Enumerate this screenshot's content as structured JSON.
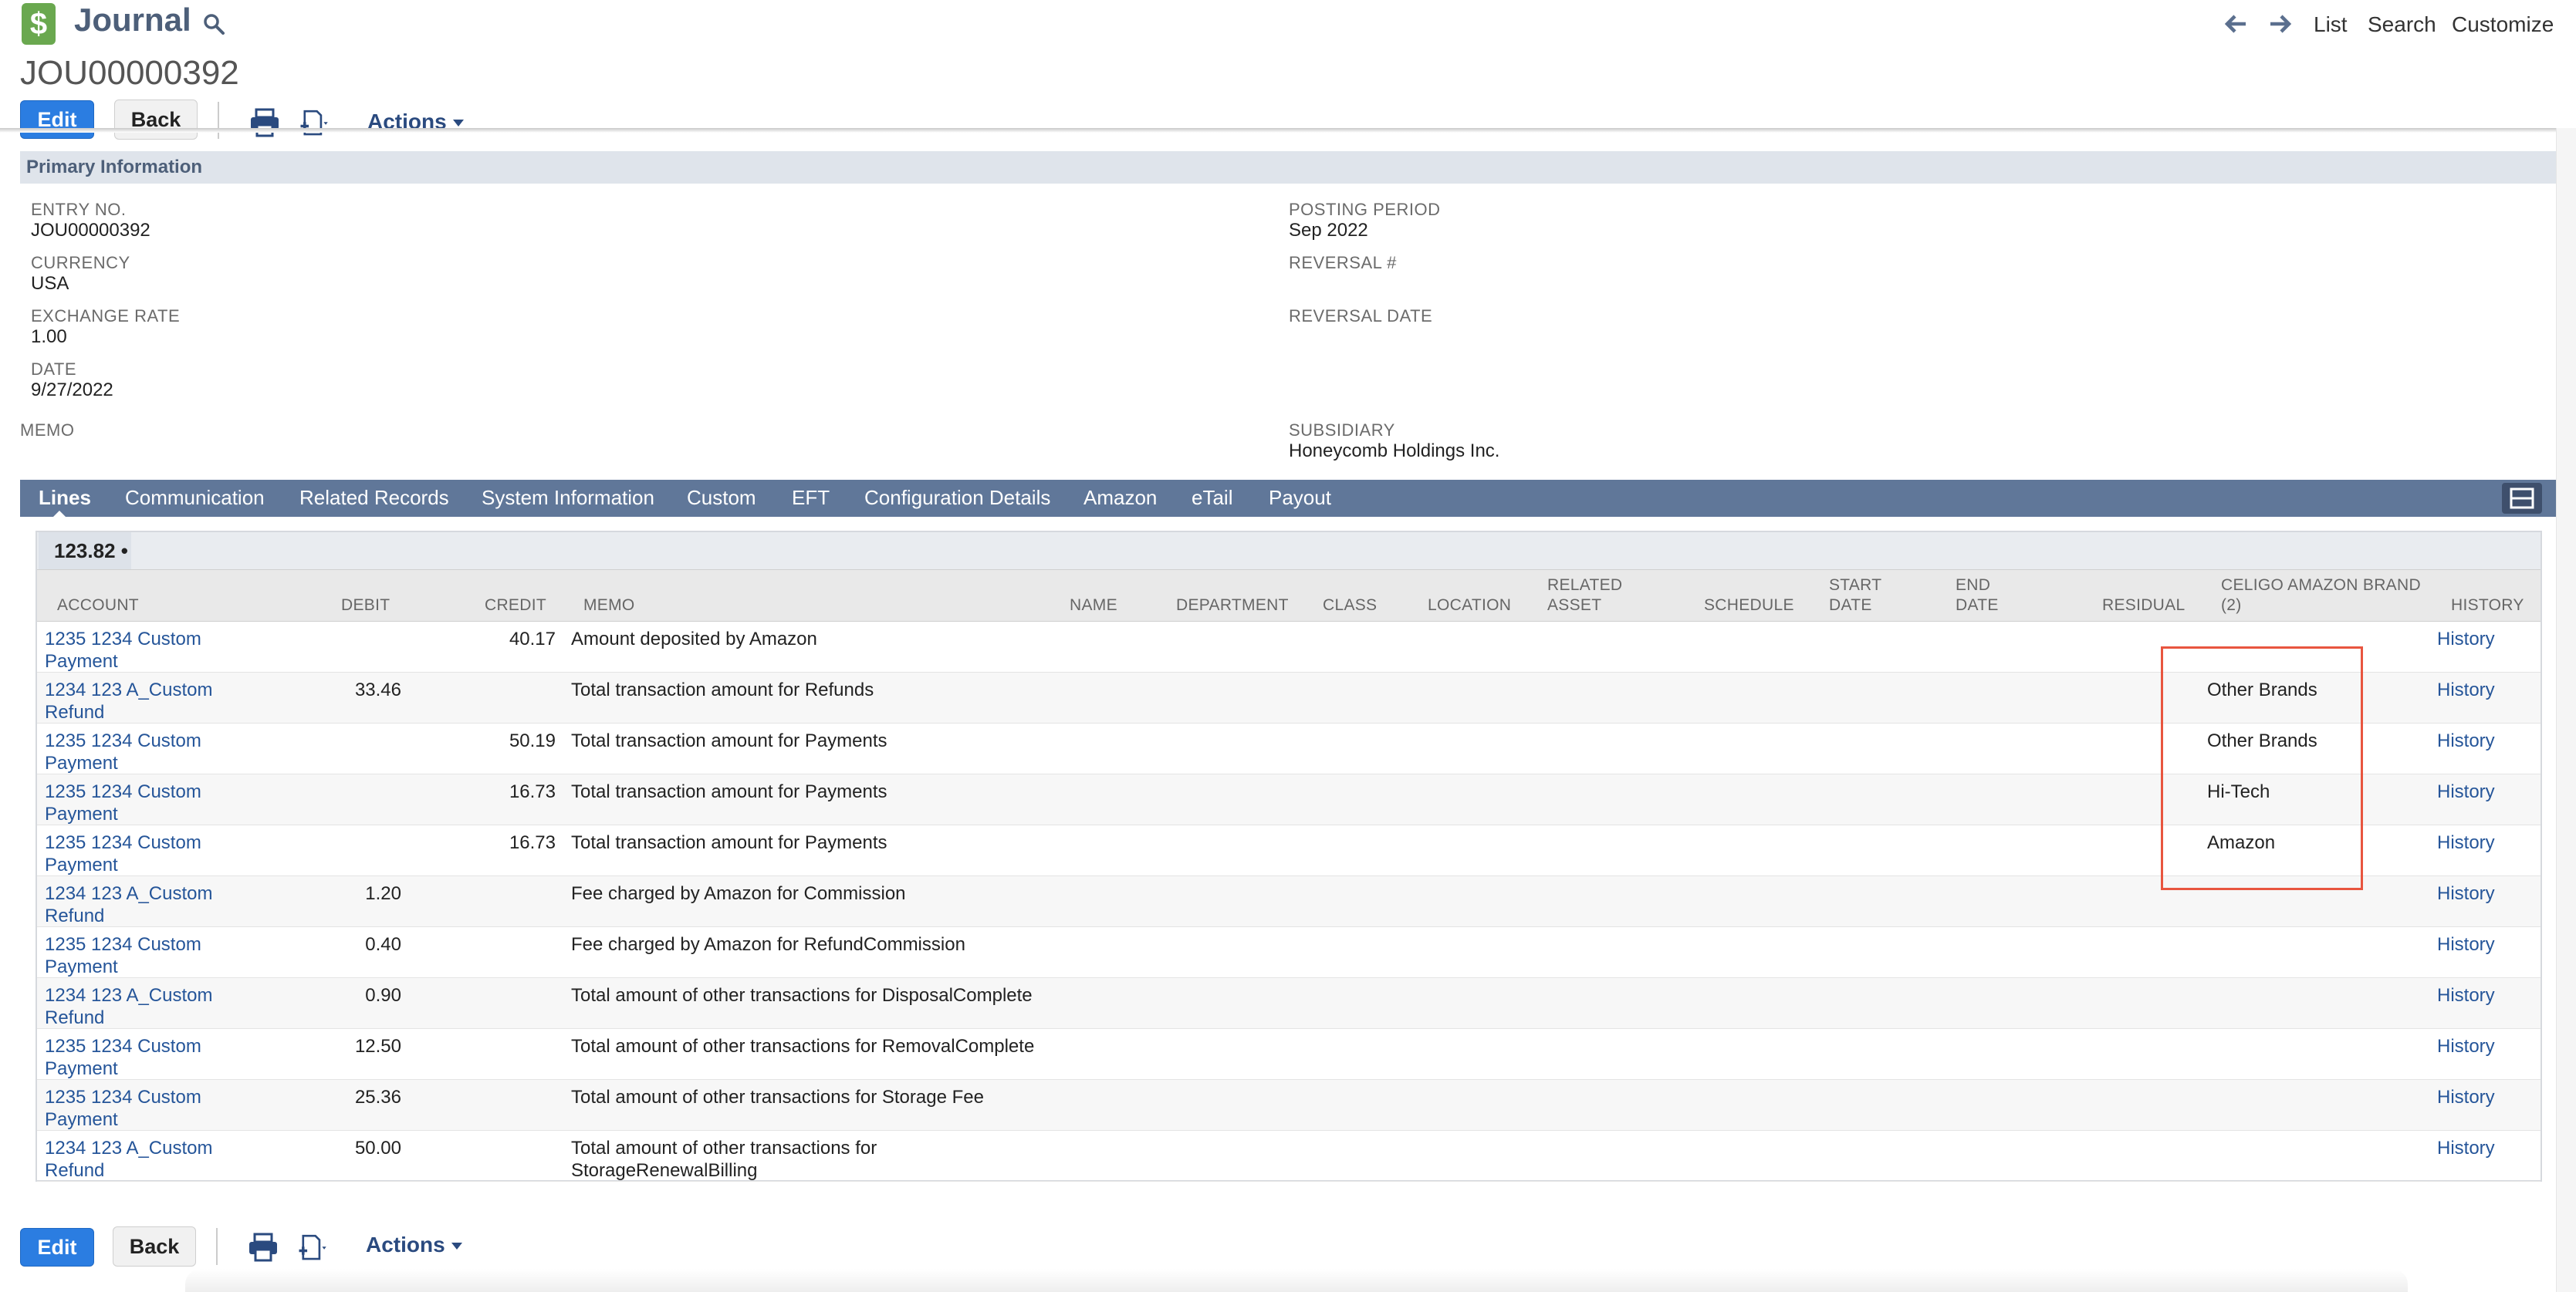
{
  "header": {
    "title": "Journal",
    "record_id": "JOU00000392",
    "nav": {
      "list": "List",
      "search": "Search",
      "customize": "Customize"
    }
  },
  "toolbar": {
    "edit": "Edit",
    "back": "Back",
    "actions": "Actions"
  },
  "primary": {
    "title": "Primary Information",
    "entry_no_label": "ENTRY NO.",
    "entry_no": "JOU00000392",
    "currency_label": "CURRENCY",
    "currency": "USA",
    "exchange_rate_label": "EXCHANGE RATE",
    "exchange_rate": "1.00",
    "date_label": "DATE",
    "date": "9/27/2022",
    "memo_label": "MEMO",
    "posting_period_label": "POSTING PERIOD",
    "posting_period": "Sep 2022",
    "reversal_no_label": "REVERSAL #",
    "reversal_date_label": "REVERSAL DATE",
    "subsidiary_label": "SUBSIDIARY",
    "subsidiary": "Honeycomb Holdings Inc."
  },
  "tabs": [
    "Lines",
    "Communication",
    "Related Records",
    "System Information",
    "Custom",
    "EFT",
    "Configuration Details",
    "Amazon",
    "eTail",
    "Payout"
  ],
  "lines": {
    "subtotal": "123.82 •",
    "headers": {
      "account": "ACCOUNT",
      "debit": "DEBIT",
      "credit": "CREDIT",
      "memo": "MEMO",
      "name": "NAME",
      "department": "DEPARTMENT",
      "class": "CLASS",
      "location": "LOCATION",
      "related_asset_1": "RELATED",
      "related_asset_2": "ASSET",
      "schedule": "SCHEDULE",
      "start_date_1": "START",
      "start_date_2": "DATE",
      "end_date_1": "END",
      "end_date_2": "DATE",
      "residual": "RESIDUAL",
      "brand_1": "CELIGO AMAZON BRAND",
      "brand_2": "(2)",
      "history": "HISTORY"
    },
    "rows": [
      {
        "account1": "1235 1234 Custom",
        "account2": "Payment",
        "debit": "",
        "credit": "40.17",
        "memo1": "Amount deposited by Amazon",
        "memo2": "",
        "brand": "",
        "history": "History"
      },
      {
        "account1": "1234 123 A_Custom",
        "account2": "Refund",
        "debit": "33.46",
        "credit": "",
        "memo1": "Total transaction amount for Refunds",
        "memo2": "",
        "brand": "Other Brands",
        "history": "History"
      },
      {
        "account1": "1235 1234 Custom",
        "account2": "Payment",
        "debit": "",
        "credit": "50.19",
        "memo1": "Total transaction amount for Payments",
        "memo2": "",
        "brand": "Other Brands",
        "history": "History"
      },
      {
        "account1": "1235 1234 Custom",
        "account2": "Payment",
        "debit": "",
        "credit": "16.73",
        "memo1": "Total transaction amount for Payments",
        "memo2": "",
        "brand": "Hi-Tech",
        "history": "History"
      },
      {
        "account1": "1235 1234 Custom",
        "account2": "Payment",
        "debit": "",
        "credit": "16.73",
        "memo1": "Total transaction amount for Payments",
        "memo2": "",
        "brand": "Amazon",
        "history": "History"
      },
      {
        "account1": "1234 123 A_Custom",
        "account2": "Refund",
        "debit": "1.20",
        "credit": "",
        "memo1": "Fee charged by Amazon for Commission",
        "memo2": "",
        "brand": "",
        "history": "History"
      },
      {
        "account1": "1235 1234 Custom",
        "account2": "Payment",
        "debit": "0.40",
        "credit": "",
        "memo1": "Fee charged by Amazon for RefundCommission",
        "memo2": "",
        "brand": "",
        "history": "History"
      },
      {
        "account1": "1234 123 A_Custom",
        "account2": "Refund",
        "debit": "0.90",
        "credit": "",
        "memo1": "Total amount of other transactions for DisposalComplete",
        "memo2": "",
        "brand": "",
        "history": "History"
      },
      {
        "account1": "1235 1234 Custom",
        "account2": "Payment",
        "debit": "12.50",
        "credit": "",
        "memo1": "Total amount of other transactions for RemovalComplete",
        "memo2": "",
        "brand": "",
        "history": "History"
      },
      {
        "account1": "1235 1234 Custom",
        "account2": "Payment",
        "debit": "25.36",
        "credit": "",
        "memo1": "Total amount of other transactions for Storage Fee",
        "memo2": "",
        "brand": "",
        "history": "History"
      },
      {
        "account1": "1234 123 A_Custom",
        "account2": "Refund",
        "debit": "50.00",
        "credit": "",
        "memo1": "Total amount of other transactions for",
        "memo2": "StorageRenewalBilling",
        "brand": "",
        "history": "History"
      }
    ]
  },
  "colors": {
    "accent": "#2b7de1",
    "tabbar": "#607799",
    "highlight": "#e8553f",
    "link": "#255599"
  }
}
